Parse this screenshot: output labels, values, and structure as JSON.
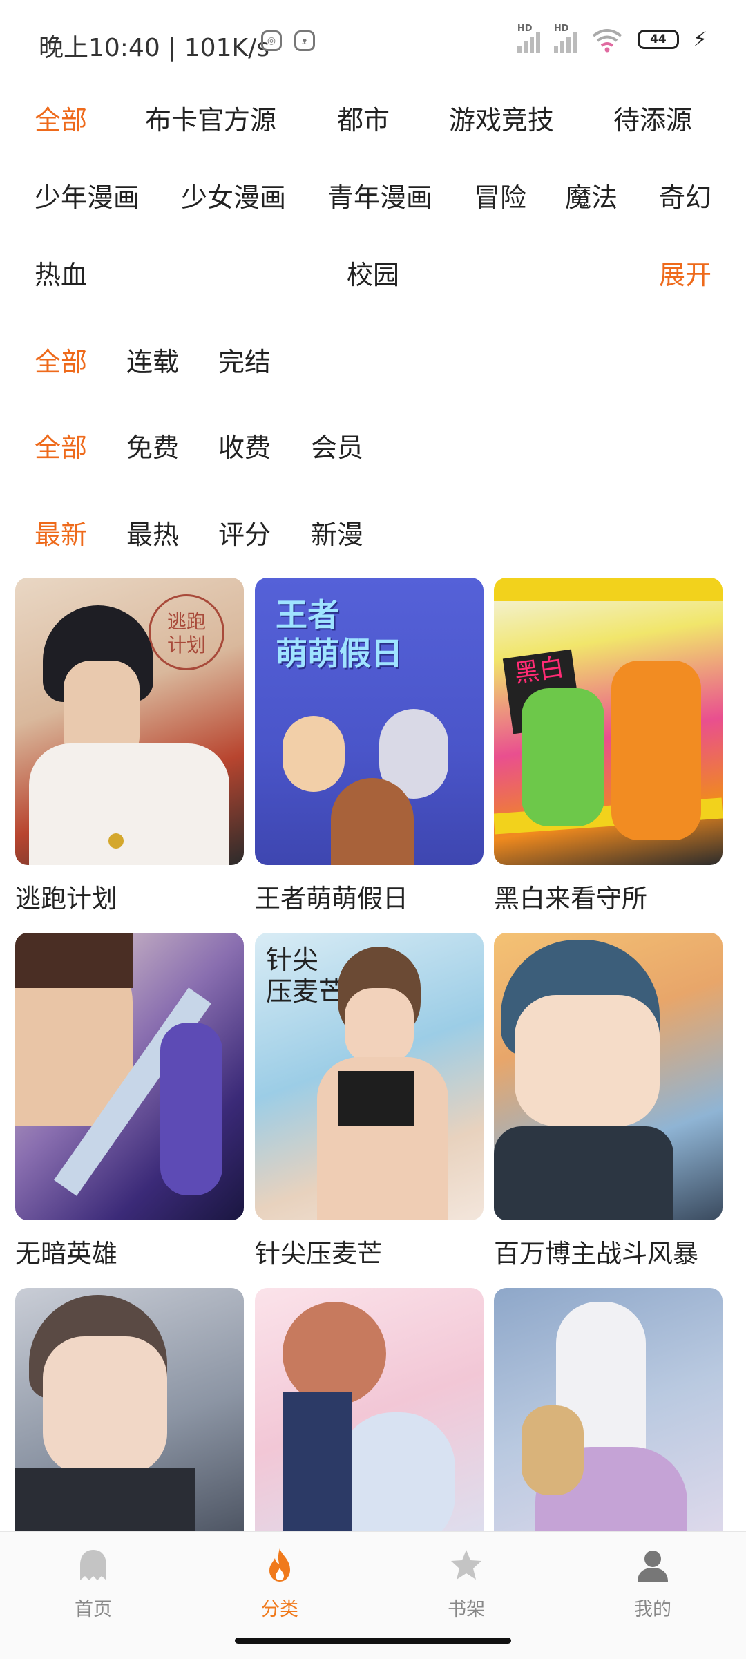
{
  "status_bar": {
    "time_text": "晚上10:40 | 101K/s",
    "signal_label": "HD",
    "battery_level": "44"
  },
  "filters": {
    "genre": [
      "全部",
      "布卡官方源",
      "都市",
      "游戏竞技",
      "待添源",
      "少年漫画",
      "少女漫画",
      "青年漫画",
      "冒险",
      "魔法",
      "奇幻",
      "热血",
      "校园"
    ],
    "expand_label": "展开",
    "status": [
      "全部",
      "连载",
      "完结"
    ],
    "price": [
      "全部",
      "免费",
      "收费",
      "会员"
    ],
    "sort": [
      "最新",
      "最热",
      "评分",
      "新漫"
    ]
  },
  "comics": [
    {
      "title": "逃跑计划",
      "cover_text": "逃跑\n计划"
    },
    {
      "title": "王者萌萌假日",
      "cover_text": "王者\n萌萌假日"
    },
    {
      "title": "黑白来看守所",
      "cover_text": "黑白\n來"
    },
    {
      "title": "无暗英雄"
    },
    {
      "title": "针尖压麦芒",
      "cover_text": "针尖\n压麦芒"
    },
    {
      "title": "百万博主战斗风暴"
    },
    {
      "title": ""
    },
    {
      "title": ""
    },
    {
      "title": ""
    }
  ],
  "nav": {
    "items": [
      "首页",
      "分类",
      "书架",
      "我的"
    ],
    "active": "分类"
  },
  "colors": {
    "accent": "#ee6a1b",
    "text": "#222222",
    "inactive_nav": "#888888"
  }
}
